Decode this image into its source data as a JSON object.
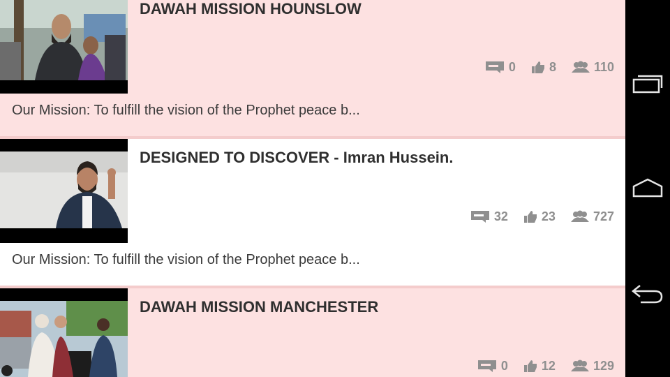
{
  "videos": [
    {
      "title": "DAWAH MISSION HOUNSLOW",
      "description": "Our Mission: To fulfill the vision of the Prophet peace b...",
      "comments": "0",
      "likes": "8",
      "views": "110"
    },
    {
      "title": "DESIGNED TO DISCOVER - Imran Hussein.",
      "description": "Our Mission: To fulfill the vision of the Prophet peace b...",
      "comments": "32",
      "likes": "23",
      "views": "727"
    },
    {
      "title": "DAWAH MISSION MANCHESTER",
      "description": "",
      "comments": "0",
      "likes": "12",
      "views": "129"
    }
  ],
  "icons": {
    "comment": "comment-icon",
    "like": "thumbs-up-icon",
    "views": "viewers-icon",
    "recents": "recent-apps-icon",
    "home": "home-icon",
    "back": "back-icon",
    "pager": "chevron-right-icon"
  },
  "colors": {
    "card_pink": "#fde1e1",
    "card_white": "#ffffff",
    "stat_gray": "#8f8f8f",
    "title": "#2f2f2f",
    "navbar": "#000000"
  }
}
